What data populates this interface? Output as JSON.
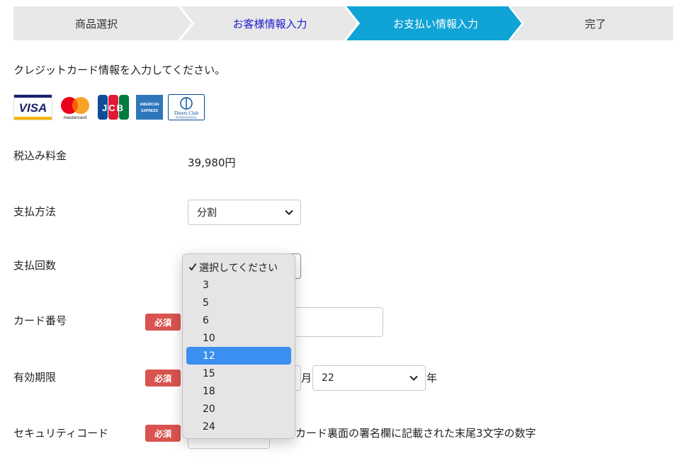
{
  "steps": [
    {
      "label": "商品選択",
      "state": "done"
    },
    {
      "label": "お客様情報入力",
      "state": "link"
    },
    {
      "label": "お支払い情報入力",
      "state": "active"
    },
    {
      "label": "完了",
      "state": "pending"
    }
  ],
  "colors": {
    "active_step": "#0fa3d6",
    "step_link": "#1a1ad0",
    "required_badge": "#d9534f",
    "highlight": "#3a8ff0"
  },
  "intro_text": "クレジットカード情報を入力してください。",
  "card_brands": {
    "visa": "VISA",
    "mastercard": "mastercard",
    "jcb": "JCB",
    "amex_line1": "AMERICAN",
    "amex_line2": "EXPRESS",
    "diners_line1": "Diners Club",
    "diners_line2": "INTERNATIONAL"
  },
  "form": {
    "price_label": "税込み料金",
    "price_value": "39,980円",
    "method_label": "支払方法",
    "method_value": "分割",
    "installments_label": "支払回数",
    "card_number_label": "カード番号",
    "expiry_label": "有効期限",
    "expiry_month_suffix": "月",
    "expiry_year_value": "22",
    "expiry_year_suffix": "年",
    "security_label": "セキュリティコード",
    "security_hint": "カード裏面の署名欄に記載された末尾3文字の数字",
    "required_badge": "必須"
  },
  "dropdown": {
    "options": [
      "選択してください",
      "3",
      "5",
      "6",
      "10",
      "12",
      "15",
      "18",
      "20",
      "24"
    ],
    "checked": "選択してください",
    "highlighted": "12"
  }
}
